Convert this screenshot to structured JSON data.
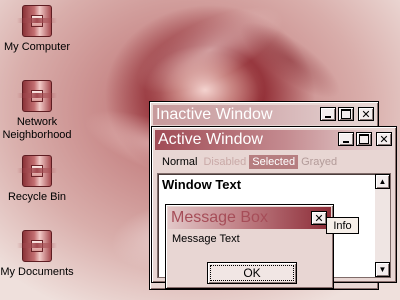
{
  "desktop": {
    "icons": [
      {
        "label": "My Computer",
        "icon": "computer-icon"
      },
      {
        "label": "Network\nNeighborhood",
        "icon": "network-icon"
      },
      {
        "label": "Recycle Bin",
        "icon": "recycle-bin-icon"
      },
      {
        "label": "My Documents",
        "icon": "documents-icon"
      }
    ]
  },
  "inactive_window": {
    "title": "Inactive Window"
  },
  "active_window": {
    "title": "Active Window",
    "menu": {
      "normal": "Normal",
      "disabled": "Disabled",
      "selected": "Selected",
      "grayed": "Grayed"
    },
    "window_text": "Window Text"
  },
  "message_box": {
    "title": "Message Box",
    "text": "Message Text",
    "ok_label": "OK"
  },
  "tooltip": {
    "text": "Info"
  },
  "caption_buttons": {
    "close_glyph": "✕"
  },
  "colors": {
    "active_title_start": "#a04b55",
    "inactive_title_start": "#c79a9c",
    "selected_menu": "#b67e80",
    "window_background": "#e8d6d3"
  }
}
